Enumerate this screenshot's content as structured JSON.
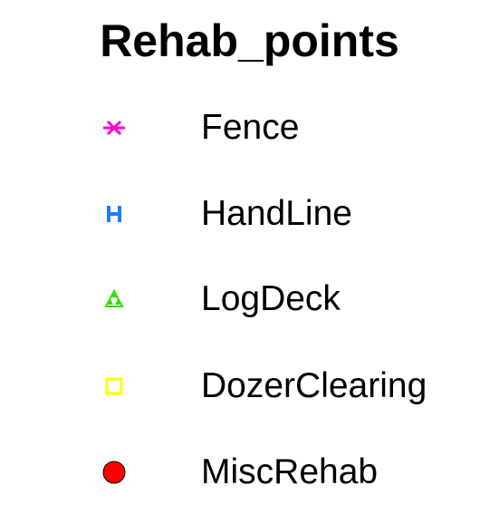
{
  "legend": {
    "title": "Rehab_points",
    "items": [
      {
        "label": "Fence",
        "icon": "pink-asterisk-icon",
        "color": "#ff00cc"
      },
      {
        "label": "HandLine",
        "icon": "blue-h-icon",
        "color": "#1f7bff"
      },
      {
        "label": "LogDeck",
        "icon": "green-triangle-icon",
        "color": "#33dd00"
      },
      {
        "label": "DozerClearing",
        "icon": "yellow-square-icon",
        "color": "#ffff00"
      },
      {
        "label": "MiscRehab",
        "icon": "red-circle-icon",
        "color": "#ff0000"
      }
    ]
  }
}
